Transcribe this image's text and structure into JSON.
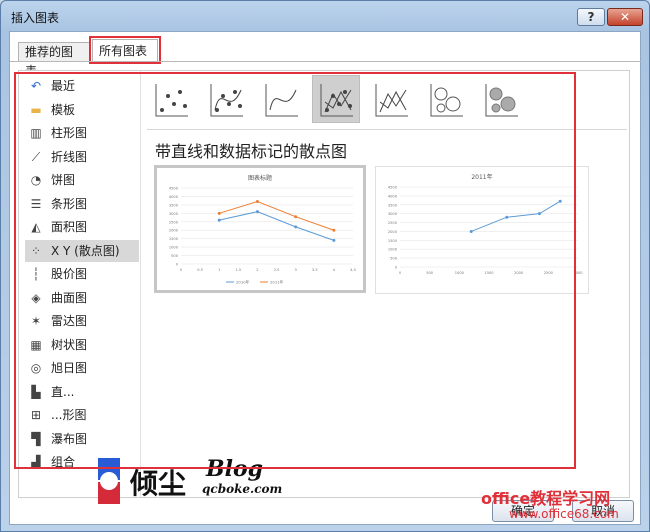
{
  "window": {
    "title": "插入图表",
    "help": "?",
    "close": "✕"
  },
  "tabs": [
    {
      "label": "推荐的图表"
    },
    {
      "label": "所有图表"
    }
  ],
  "sidebar": {
    "items": [
      {
        "label": "最近",
        "icon": "recent-icon"
      },
      {
        "label": "模板",
        "icon": "folder-icon"
      },
      {
        "label": "柱形图",
        "icon": "column-chart-icon"
      },
      {
        "label": "折线图",
        "icon": "line-chart-icon"
      },
      {
        "label": "饼图",
        "icon": "pie-chart-icon"
      },
      {
        "label": "条形图",
        "icon": "bar-chart-icon"
      },
      {
        "label": "面积图",
        "icon": "area-chart-icon"
      },
      {
        "label": "X Y (散点图)",
        "icon": "scatter-chart-icon",
        "selected": true
      },
      {
        "label": "股价图",
        "icon": "stock-chart-icon"
      },
      {
        "label": "曲面图",
        "icon": "surface-chart-icon"
      },
      {
        "label": "雷达图",
        "icon": "radar-chart-icon"
      },
      {
        "label": "树状图",
        "icon": "treemap-chart-icon"
      },
      {
        "label": "旭日图",
        "icon": "sunburst-chart-icon"
      },
      {
        "label": "直...",
        "icon": "histogram-chart-icon"
      },
      {
        "label": "...形图",
        "icon": "box-whisker-chart-icon"
      },
      {
        "label": "瀑布图",
        "icon": "waterfall-chart-icon"
      },
      {
        "label": "组合",
        "icon": "combo-chart-icon"
      }
    ]
  },
  "subtypes": {
    "selected_title": "带直线和数据标记的散点图",
    "icons": [
      "scatter-subtype-icon",
      "scatter-smooth-markers-subtype-icon",
      "scatter-smooth-lines-subtype-icon",
      "scatter-straight-markers-subtype-icon",
      "scatter-straight-lines-subtype-icon",
      "bubble-subtype-icon",
      "bubble-3d-subtype-icon"
    ],
    "selected_index": 3
  },
  "chart_data": [
    {
      "type": "scatter",
      "title": "图表标题",
      "xlim": [
        0,
        4.5
      ],
      "ylim": [
        0,
        4500
      ],
      "x_ticks": [
        "0",
        "0.5",
        "1",
        "1.5",
        "2",
        "2.5",
        "3",
        "3.5",
        "4",
        "4.5"
      ],
      "y_ticks": [
        "0",
        "500",
        "1000",
        "1500",
        "2000",
        "2500",
        "3000",
        "3500",
        "4000",
        "4500"
      ],
      "series": [
        {
          "name": "2010年",
          "color": "#5b9bd5",
          "x": [
            1,
            2,
            3,
            4
          ],
          "y": [
            2600,
            3100,
            2200,
            1400
          ]
        },
        {
          "name": "2011年",
          "color": "#ed7d31",
          "x": [
            1,
            2,
            3,
            4
          ],
          "y": [
            3000,
            3700,
            2800,
            2000
          ]
        }
      ],
      "legend": "bottom"
    },
    {
      "type": "scatter",
      "title": "2011年",
      "xlim": [
        0,
        3000
      ],
      "ylim": [
        0,
        4500
      ],
      "x_ticks": [
        "0",
        "500",
        "1000",
        "1500",
        "2000",
        "2500",
        "3000"
      ],
      "y_ticks": [
        "0",
        "500",
        "1000",
        "1500",
        "2000",
        "2500",
        "3000",
        "3500",
        "4000",
        "4500"
      ],
      "series": [
        {
          "color": "#5b9bd5",
          "x": [
            1200,
            1800,
            2350,
            2700
          ],
          "y": [
            2000,
            2800,
            3000,
            3700
          ]
        }
      ]
    }
  ],
  "footer": {
    "ok": "确定",
    "cancel": "取消"
  },
  "watermark": {
    "name": "倾尘",
    "blog": "Blog",
    "url": "qcboke.com"
  },
  "office_watermark": {
    "line1": "office教程学习网",
    "line2": "www.office68.com"
  },
  "colors": {
    "highlight": "#e0303a",
    "accent": "#5b9bd5",
    "accent2": "#ed7d31"
  }
}
